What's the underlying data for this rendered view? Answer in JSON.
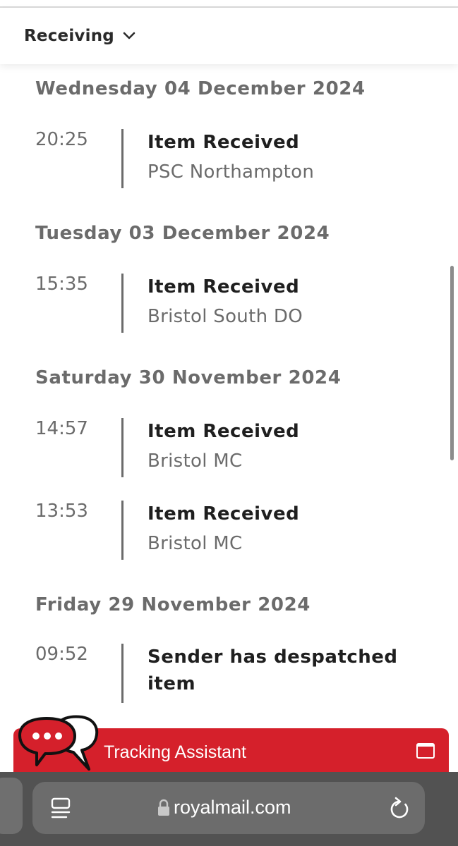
{
  "header": {
    "title": "Receiving",
    "chevron_icon": "chevron-down-icon"
  },
  "timeline": [
    {
      "date": "Wednesday 04 December 2024",
      "events": [
        {
          "time": "20:25",
          "status": "Item Received",
          "location": "PSC Northampton"
        }
      ]
    },
    {
      "date": "Tuesday 03 December 2024",
      "events": [
        {
          "time": "15:35",
          "status": "Item Received",
          "location": "Bristol South DO"
        }
      ]
    },
    {
      "date": "Saturday 30 November 2024",
      "events": [
        {
          "time": "14:57",
          "status": "Item Received",
          "location": "Bristol MC"
        },
        {
          "time": "13:53",
          "status": "Item Received",
          "location": "Bristol MC"
        }
      ]
    },
    {
      "date": "Friday 29 November 2024",
      "events": [
        {
          "time": "09:52",
          "status": "Sender has despatched item",
          "location": ""
        }
      ]
    }
  ],
  "assistant": {
    "label": "Tracking Assistant",
    "accent": "#d5202b",
    "chat_icon": "chat-bubbles-icon",
    "expand_icon": "window-icon"
  },
  "browser": {
    "url": "royalmail.com",
    "lock_icon": "lock-icon",
    "page_icon": "page-menu-icon",
    "reload_icon": "reload-icon"
  }
}
